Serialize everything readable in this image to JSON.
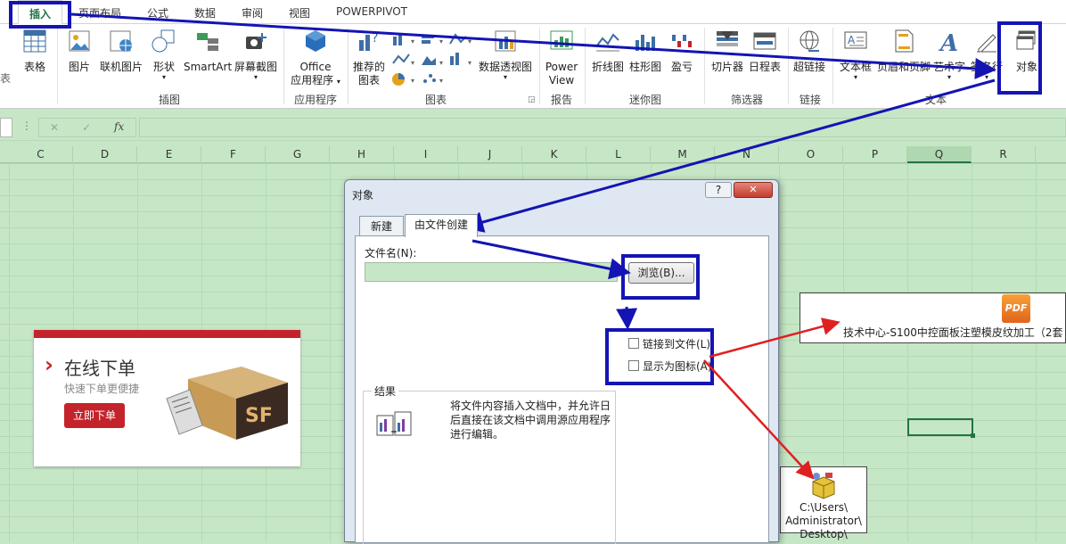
{
  "menu": {
    "tabs": [
      "插入",
      "页面布局",
      "公式",
      "数据",
      "审阅",
      "视图",
      "POWERPIVOT"
    ]
  },
  "ribbon": {
    "table": "表格",
    "picture": "图片",
    "online_picture": "联机图片",
    "shapes": "形状",
    "smartart": "SmartArt",
    "screenshot": "屏幕截图",
    "office": "Office",
    "apps": "应用程序",
    "recommended": "推荐的",
    "charts_word": "图表",
    "pivotchart": "数据透视图",
    "powerview1": "Power",
    "powerview2": "View",
    "line": "折线图",
    "column": "柱形图",
    "winloss": "盈亏",
    "slicer": "切片器",
    "timeline": "日程表",
    "hyperlink": "超链接",
    "textbox": "文本框",
    "header": "页眉和页脚",
    "wordart": "艺术字",
    "signature": "签名行",
    "object": "对象",
    "groups": {
      "illustrations": "插图",
      "apps": "应用程序",
      "charts": "图表",
      "reports": "报告",
      "sparklines": "迷你图",
      "filters": "筛选器",
      "links": "链接",
      "text": "文本"
    },
    "left_cut": "表"
  },
  "formula_bar": {
    "cancel": "✕",
    "enter": "✓",
    "fx": "fx",
    "more": "⋮"
  },
  "columns": [
    "C",
    "D",
    "E",
    "F",
    "G",
    "H",
    "I",
    "J",
    "K",
    "L",
    "M",
    "N",
    "O",
    "P",
    "Q",
    "R"
  ],
  "sf_card": {
    "title": "在线下单",
    "subtitle": "快速下单更便捷",
    "button": "立即下单",
    "chevron": "›",
    "logo": "SF"
  },
  "dialog": {
    "title": "对象",
    "help": "?",
    "close": "✕",
    "tabs": [
      "新建",
      "由文件创建"
    ],
    "filename_label": "文件名(N):",
    "filename_value": "",
    "browse": "浏览(B)...",
    "link_label": "链接到文件(L)",
    "icon_label": "显示为图标(A)",
    "result_label": "结果",
    "result_text": "将文件内容插入文档中，并允许日后直接在该文档中调用源应用程序进行编辑。"
  },
  "pdf_object": {
    "label": "技术中心-S100中控面板注塑模皮纹加工（2套",
    "icon": "PDF"
  },
  "package_object": {
    "line1": "C:\\Users\\",
    "line2": "Administrator\\",
    "line3": "Desktop\\"
  }
}
